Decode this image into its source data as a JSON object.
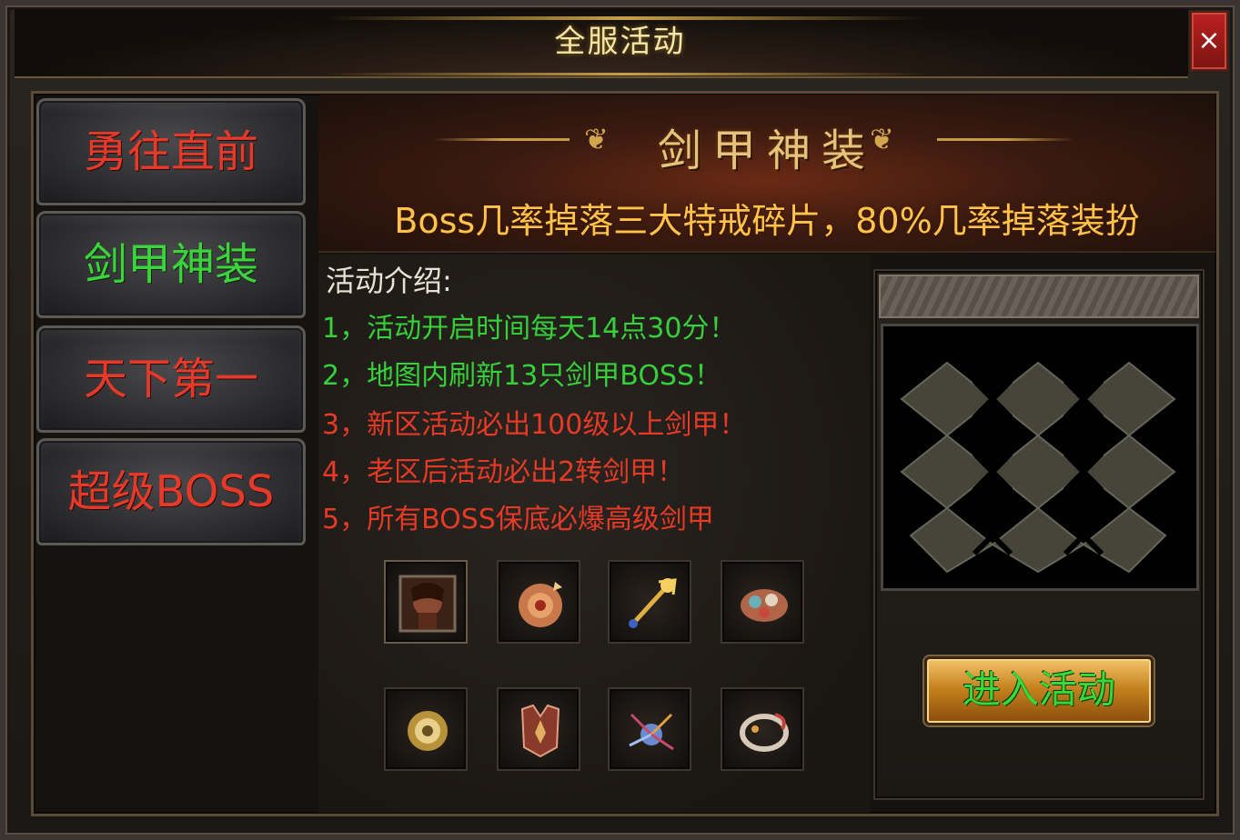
{
  "window": {
    "title": "全服活动",
    "close_label": "×"
  },
  "sidebar": {
    "items": [
      {
        "label": "勇往直前",
        "color": "red"
      },
      {
        "label": "剑甲神装",
        "color": "green"
      },
      {
        "label": "天下第一",
        "color": "red"
      },
      {
        "label": "超级BOSS",
        "color": "red"
      }
    ]
  },
  "banner": {
    "title": "剑甲神装",
    "subtitle": "Boss几率掉落三大特戒碎片，80%几率掉落装扮"
  },
  "activity": {
    "intro_title": "活动介绍:",
    "rules": [
      {
        "text": "1，活动开启时间每天14点30分！",
        "color": "green"
      },
      {
        "text": "2，地图内刷新13只剑甲BOSS！",
        "color": "green"
      },
      {
        "text": "3，新区活动必出100级以上剑甲！",
        "color": "red"
      },
      {
        "text": "4，老区后活动必出2转剑甲！",
        "color": "red"
      },
      {
        "text": "5，所有BOSS保底必爆高级剑甲",
        "color": "red"
      }
    ]
  },
  "rewards": {
    "items": [
      {
        "icon": "portrait-icon"
      },
      {
        "icon": "orb-icon"
      },
      {
        "icon": "scepter-icon"
      },
      {
        "icon": "gem-cluster-icon"
      },
      {
        "icon": "gold-ring-icon"
      },
      {
        "icon": "armor-icon"
      },
      {
        "icon": "crystal-spray-icon"
      },
      {
        "icon": "dragon-ring-icon"
      }
    ]
  },
  "map": {
    "enter_button": "进入活动"
  },
  "colors": {
    "accent_gold": "#e6c27a",
    "text_green": "#35d03a",
    "text_red": "#e63a26",
    "close_red": "#b22"
  }
}
